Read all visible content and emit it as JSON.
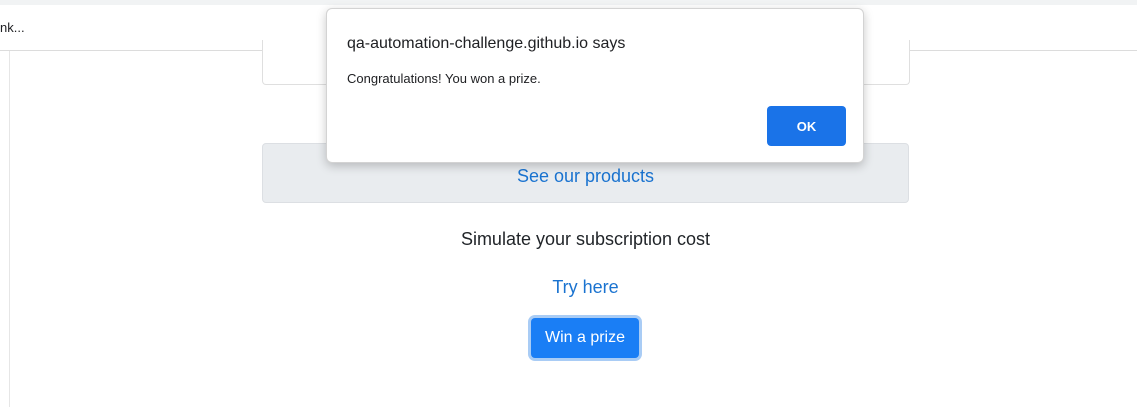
{
  "browser": {
    "tab_text": "nk..."
  },
  "page": {
    "products_link": "See our products",
    "simulate_text": "Simulate your subscription cost",
    "try_link": "Try here",
    "win_button": "Win a prize"
  },
  "alert": {
    "origin": "qa-automation-challenge.github.io says",
    "message": "Congratulations! You won a prize.",
    "ok_label": "OK"
  },
  "colors": {
    "link": "#1a73d0",
    "button_primary": "#1a7ef5",
    "alert_ok": "#1a73e8",
    "products_box_bg": "#e9ecef"
  }
}
